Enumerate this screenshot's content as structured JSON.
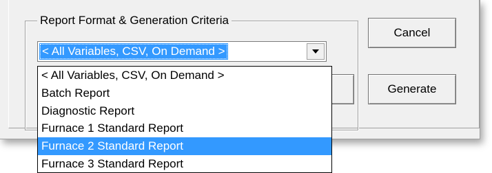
{
  "groupbox": {
    "title": "Report Format & Generation Criteria"
  },
  "combo": {
    "selected_value": "< All Variables, CSV, On Demand >",
    "arrow_icon": "chevron-down-icon"
  },
  "dropdown": {
    "items": [
      "< All Variables, CSV, On Demand >",
      "Batch Report",
      "Diagnostic Report",
      "Furnace 1 Standard Report",
      "Furnace 2 Standard Report",
      "Furnace 3 Standard Report"
    ],
    "highlighted_item": "Furnace 2 Standard Report"
  },
  "buttons": {
    "cancel_label": "Cancel",
    "generate_label": "Generate"
  },
  "colors": {
    "selection": "#3399ff",
    "dialog_background": "#f0f0f0"
  }
}
